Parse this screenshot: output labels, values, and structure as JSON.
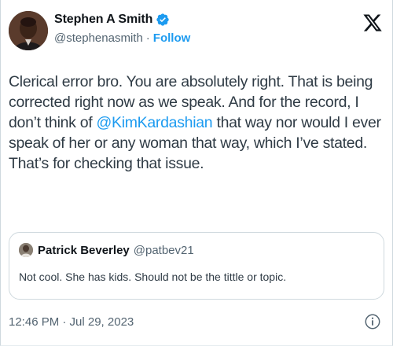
{
  "author": {
    "display_name": "Stephen A Smith",
    "handle": "@stephenasmith",
    "separator": "·",
    "follow_label": "Follow",
    "verified_icon": "verified-badge-icon"
  },
  "tweet": {
    "text_before_mention": "Clerical error bro. You are absolutely right.  That is being corrected right now as we speak. And for the record, I don’t think of ",
    "mention": "@KimKardashian",
    "text_after_mention": " that way nor would I ever speak of her or any woman that way, which I’ve stated. That’s for checking that issue."
  },
  "quoted_tweet": {
    "display_name": "Patrick Beverley",
    "handle": "@patbev21",
    "text": "Not cool. She has kids. Should not be the tittle or topic."
  },
  "footer": {
    "timestamp": "12:46 PM · Jul 29, 2023",
    "info_icon": "info-icon"
  },
  "colors": {
    "accent": "#1d9bf0",
    "text": "#0f1419",
    "muted": "#536471",
    "border": "#cfd9de"
  }
}
